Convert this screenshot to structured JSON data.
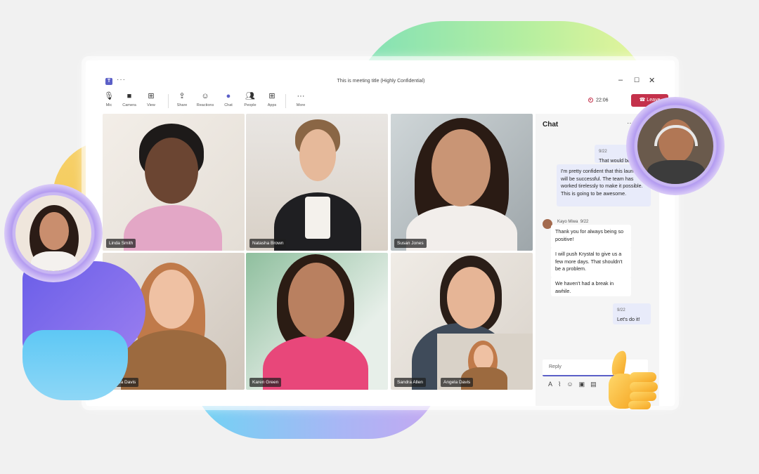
{
  "window": {
    "title": "This is meeting title (Highly Confidential)",
    "more_icon": "ellipsis-icon"
  },
  "toolbar": {
    "items": [
      {
        "label": "Mic",
        "icon": "mic-icon"
      },
      {
        "label": "Camera",
        "icon": "camera-icon"
      },
      {
        "label": "View",
        "icon": "grid-view-icon"
      },
      {
        "label": "Share",
        "icon": "share-icon"
      },
      {
        "label": "Reactions",
        "icon": "reactions-icon"
      },
      {
        "label": "Chat",
        "icon": "chat-icon"
      },
      {
        "label": "People",
        "icon": "people-icon"
      },
      {
        "label": "Apps",
        "icon": "apps-icon"
      },
      {
        "label": "More",
        "icon": "ellipsis-icon"
      }
    ],
    "timer": "22:06",
    "leave_label": "Leave"
  },
  "participants": [
    {
      "name": "Linda Smith"
    },
    {
      "name": "Natasha Brown"
    },
    {
      "name": "Susan Jones"
    },
    {
      "name": "Angela Davis"
    },
    {
      "name": "Karen Green"
    },
    {
      "name": "Sandra Allen"
    }
  ],
  "self_view": {
    "name": "Angela Davis"
  },
  "chat": {
    "title": "Chat",
    "messages": [
      {
        "from": "me",
        "time": "9/22",
        "text": "That would be great"
      },
      {
        "from": "me",
        "time": "",
        "text": "I'm pretty confident that this launch will be successful. The team has worked tirelessly to make it possible. This is going to be awesome."
      },
      {
        "from": "Kayo Miwa",
        "time": "9/22",
        "text": "Thank you for always being so positive!"
      },
      {
        "from": "Kayo Miwa",
        "time": "",
        "text": "I will push Krystal to give us a few more days. That shouldn't be a problem."
      },
      {
        "from": "Kayo Miwa",
        "time": "",
        "text": "We haven't had a break in awhile."
      },
      {
        "from": "me",
        "time": "9/22",
        "text": "Let's do it!"
      }
    ],
    "reply_placeholder": "Reply"
  },
  "colors": {
    "accent": "#5b5fc7",
    "leave": "#c4314b"
  }
}
